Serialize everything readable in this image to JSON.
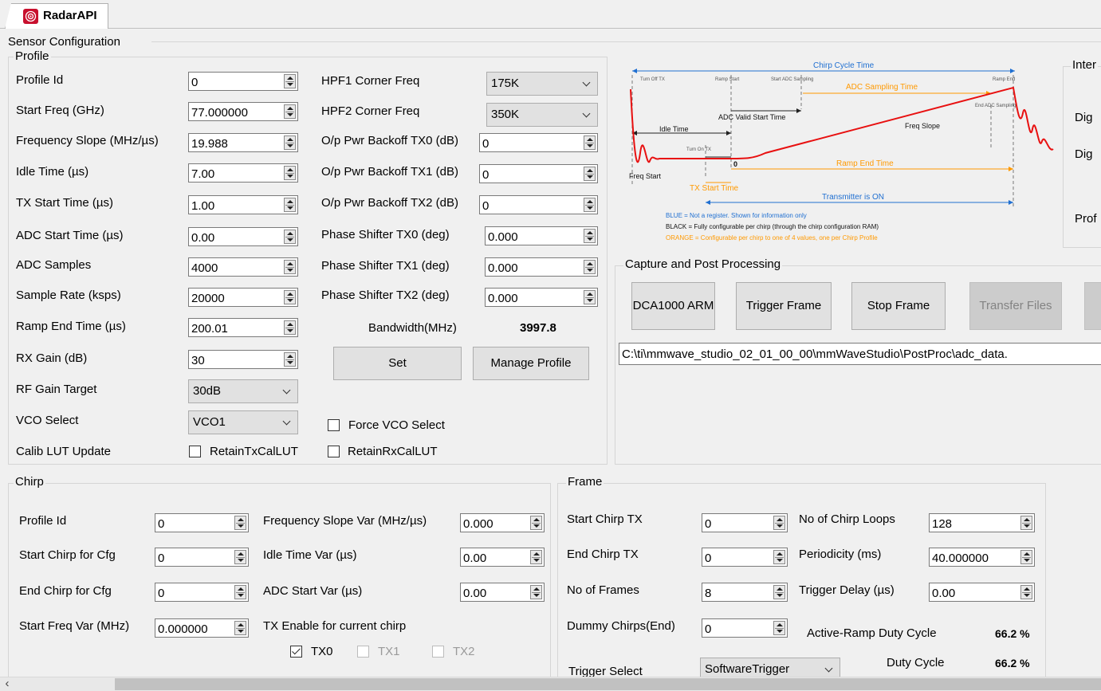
{
  "tab": {
    "title": "RadarAPI"
  },
  "sensor_config": {
    "title": "Sensor Configuration"
  },
  "profile": {
    "title": "Profile",
    "left_fields": [
      {
        "label": "Profile Id",
        "value": "0"
      },
      {
        "label": "Start Freq (GHz)",
        "value": "77.000000"
      },
      {
        "label": "Frequency Slope (MHz/µs)",
        "value": "19.988"
      },
      {
        "label": "Idle Time (µs)",
        "value": "7.00"
      },
      {
        "label": "TX Start Time (µs)",
        "value": "1.00"
      },
      {
        "label": "ADC Start Time (µs)",
        "value": "0.00"
      },
      {
        "label": "ADC Samples",
        "value": "4000"
      },
      {
        "label": "Sample Rate (ksps)",
        "value": "20000"
      },
      {
        "label": "Ramp End Time (µs)",
        "value": "200.01"
      },
      {
        "label": "RX Gain (dB)",
        "value": "30"
      }
    ],
    "rf_gain_target": {
      "label": "RF Gain Target",
      "value": "30dB"
    },
    "vco_select": {
      "label": "VCO Select",
      "value": "VCO1"
    },
    "calib_lut": {
      "label": "Calib LUT Update",
      "retain_tx": "RetainTxCalLUT",
      "retain_rx": "RetainRxCalLUT"
    },
    "hpf1": {
      "label": "HPF1 Corner Freq",
      "value": "175K"
    },
    "hpf2": {
      "label": "HPF2 Corner Freq",
      "value": "350K"
    },
    "right_fields": [
      {
        "label": "O/p Pwr Backoff TX0 (dB)",
        "value": "0"
      },
      {
        "label": "O/p Pwr Backoff TX1 (dB)",
        "value": "0"
      },
      {
        "label": "O/p Pwr Backoff TX2 (dB)",
        "value": "0"
      },
      {
        "label": "Phase Shifter TX0 (deg)",
        "value": "0.000"
      },
      {
        "label": "Phase Shifter TX1 (deg)",
        "value": "0.000"
      },
      {
        "label": "Phase Shifter TX2 (deg)",
        "value": "0.000"
      }
    ],
    "bandwidth": {
      "label": "Bandwidth(MHz)",
      "value": "3997.8"
    },
    "set_button": "Set",
    "manage_button": "Manage Profile",
    "force_vco": "Force VCO Select"
  },
  "diagram": {
    "chirp_cycle_time": "Chirp Cycle Time",
    "turn_off_tx": "Turn Off TX",
    "ramp_start": "Ramp Start",
    "start_adc_sampling": "Start ADC Sampling",
    "ramp_end": "Ramp End",
    "adc_sampling_time": "ADC Sampling Time",
    "end_adc_sampling": "End ADC Sampling",
    "adc_valid_start_time": "ADC Valid Start Time",
    "freq_slope": "Freq Slope",
    "idle_time": "Idle Time",
    "turn_on_tx": "Turn On TX",
    "zero": "0",
    "ramp_end_time": "Ramp End Time",
    "freq_start": "Freq Start",
    "tx_start_time": "TX Start Time",
    "transmitter_on": "Transmitter is ON",
    "legend_blue": "BLUE = Not a register. Shown for information only",
    "legend_black": "BLACK = Fully configurable per chirp (through the chirp configuration RAM)",
    "legend_orange": "ORANGE = Configurable per chirp to one of 4 values, one per Chirp Profile",
    "color_blue": "#1f6fd1",
    "color_orange": "#ff9900",
    "color_red": "#e81010"
  },
  "inter_panel": {
    "title": "Inter",
    "dig1": "Dig",
    "dig2": "Dig",
    "prof": "Prof"
  },
  "capture": {
    "title": "Capture and Post Processing",
    "dca_button": "DCA1000 ARM",
    "trigger_button": "Trigger Frame",
    "stop_button": "Stop Frame",
    "transfer_button": "Transfer Files",
    "path": "C:\\ti\\mmwave_studio_02_01_00_00\\mmWaveStudio\\PostProc\\adc_data."
  },
  "chirp": {
    "title": "Chirp",
    "left_fields": [
      {
        "label": "Profile Id",
        "value": "0"
      },
      {
        "label": "Start Chirp for Cfg",
        "value": "0"
      },
      {
        "label": "End Chirp for Cfg",
        "value": "0"
      },
      {
        "label": "Start Freq Var (MHz)",
        "value": "0.000000"
      }
    ],
    "right_fields": [
      {
        "label": "Frequency Slope Var (MHz/µs)",
        "value": "0.000"
      },
      {
        "label": "Idle Time Var (µs)",
        "value": "0.00"
      },
      {
        "label": "ADC Start Var (µs)",
        "value": "0.00"
      }
    ],
    "tx_enable_label": "TX Enable for current chirp",
    "tx0": "TX0",
    "tx1": "TX1",
    "tx2": "TX2"
  },
  "frame": {
    "title": "Frame",
    "left_fields": [
      {
        "label": "Start Chirp TX",
        "value": "0"
      },
      {
        "label": "End Chirp TX",
        "value": "0"
      },
      {
        "label": "No of Frames",
        "value": "8"
      },
      {
        "label": "Dummy Chirps(End)",
        "value": "0"
      }
    ],
    "right_fields": [
      {
        "label": "No of Chirp Loops",
        "value": "128"
      },
      {
        "label": "Periodicity (ms)",
        "value": "40.000000"
      },
      {
        "label": "Trigger Delay (µs)",
        "value": "0.00"
      }
    ],
    "active_ramp": {
      "label": "Active-Ramp Duty Cycle",
      "value": "66.2 %"
    },
    "duty_cycle": {
      "label": "Duty Cycle",
      "value": "66.2 %"
    },
    "trigger_select": {
      "label": "Trigger Select",
      "value": "SoftwareTrigger"
    }
  }
}
